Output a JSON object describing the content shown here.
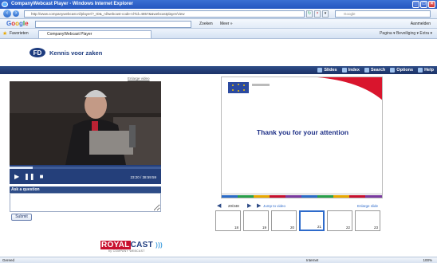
{
  "window": {
    "title": "CompanyWebcast Player - Windows Internet Explorer"
  },
  "address": {
    "url": "http://www.companywebcast.nl/player/?_ID&_nl/webcast-code-nl?id=4857&&webcastplayer/view",
    "search_placeholder": "Google"
  },
  "google": {
    "logo": "Google",
    "zoeken": "Zoeken",
    "meer": "Meer »",
    "aanmelden": "Aanmelden"
  },
  "favorites": {
    "label": "Favorieten",
    "tab": "CompanyWebcast Player",
    "tools": "Pagina ▾  Beveiliging ▾  Extra ▾"
  },
  "header": {
    "brand": "Kennis voor zaken"
  },
  "nav": {
    "slides": "Slides",
    "index": "Index",
    "search": "Search",
    "options": "Options",
    "help": "Help"
  },
  "player": {
    "enlarge_video": "Enlarge video",
    "time": "23:20 / 38:59:59",
    "progress": 0.15
  },
  "ask": {
    "header": "Ask a question",
    "submit": "Submit"
  },
  "brand_logo": {
    "royal": "ROYAL",
    "cast": "CAST",
    "sub": "by COMPANY WEBCAST"
  },
  "slide": {
    "text": "Thank you for your attention",
    "counter": "20/348",
    "jump": "Jump to video",
    "enlarge": "Enlarge slide"
  },
  "thumbs": [
    "18",
    "19",
    "20",
    "21",
    "22",
    "23"
  ],
  "statusbar": {
    "left": "Gereed",
    "zone": "Internet",
    "zoom": "100%"
  },
  "colors": {
    "accent": "#1d3b7e",
    "title": "#2456c0",
    "submit_border": "#6f85b3"
  }
}
